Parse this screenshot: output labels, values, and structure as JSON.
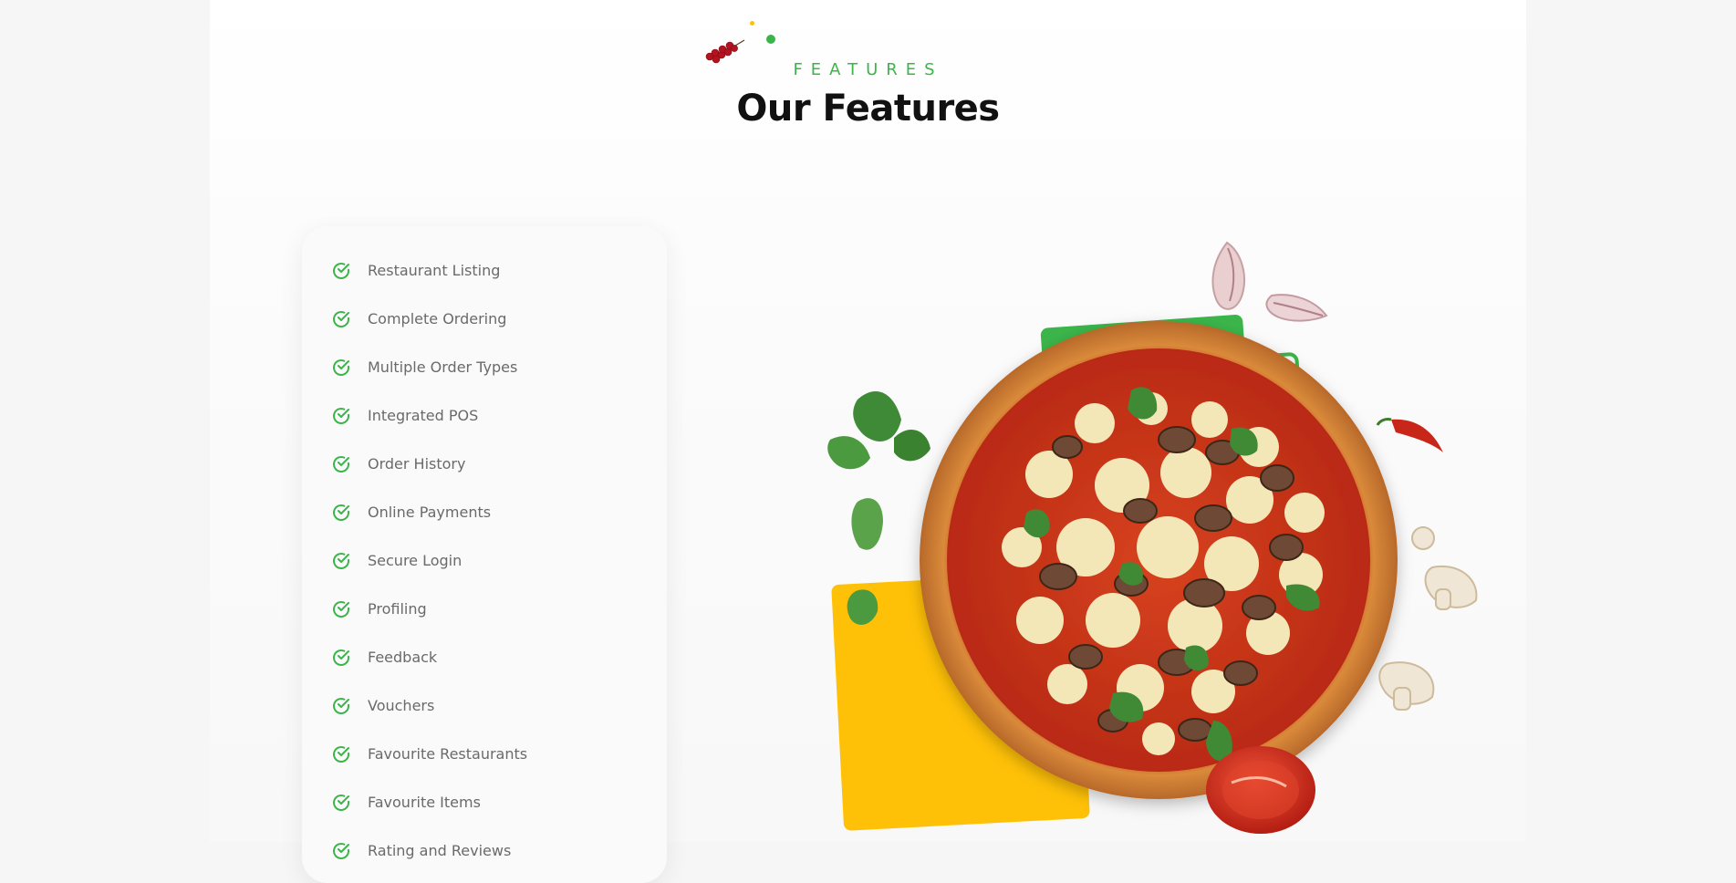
{
  "section": {
    "eyebrow": "FEATURES",
    "title": "Our Features"
  },
  "features": [
    {
      "label": "Restaurant Listing"
    },
    {
      "label": "Complete Ordering"
    },
    {
      "label": "Multiple Order Types"
    },
    {
      "label": "Integrated POS"
    },
    {
      "label": "Order History"
    },
    {
      "label": "Online Payments"
    },
    {
      "label": "Secure Login"
    },
    {
      "label": "Profiling"
    },
    {
      "label": "Feedback"
    },
    {
      "label": "Vouchers"
    },
    {
      "label": "Favourite Restaurants"
    },
    {
      "label": "Favourite Items"
    },
    {
      "label": "Rating and Reviews"
    }
  ],
  "icons": {
    "feature_check": "check-circle-icon",
    "illustration": "pizza-illustration"
  },
  "colors": {
    "accent_green": "#3bb54a",
    "accent_yellow": "#ffc107",
    "title": "#111111",
    "feature_text": "#6a6a6a"
  }
}
